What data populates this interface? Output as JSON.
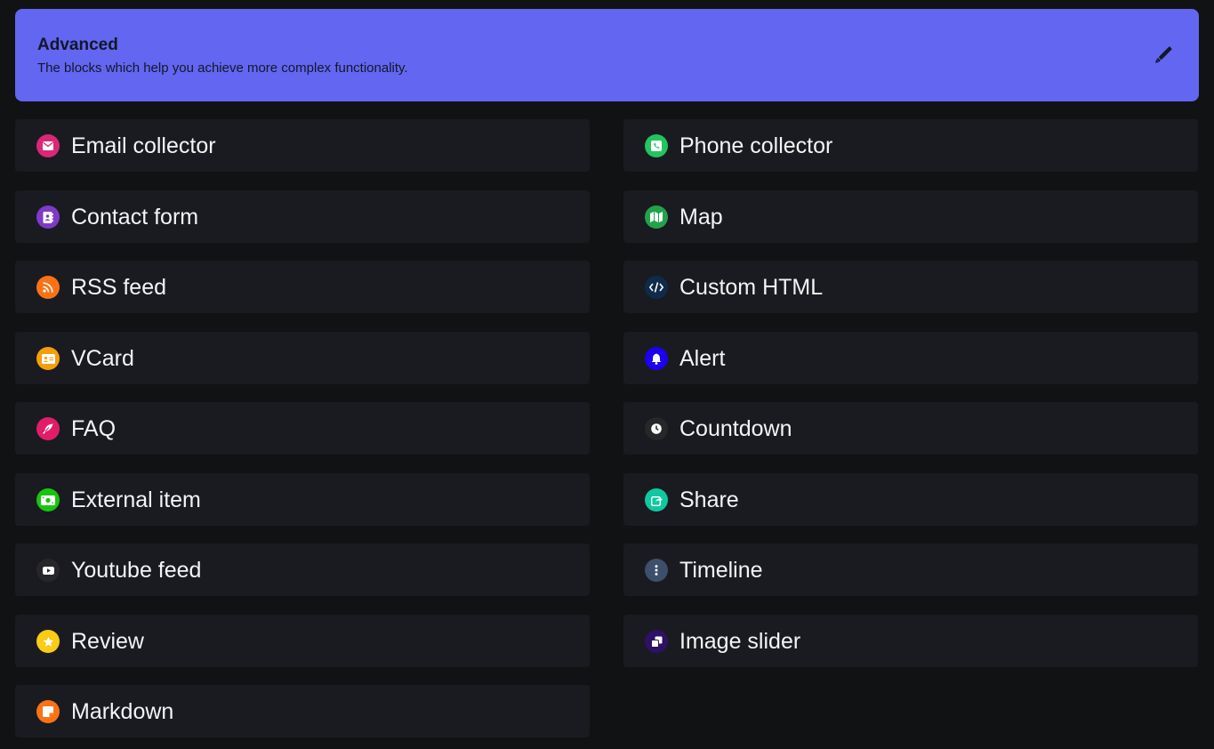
{
  "header": {
    "title": "Advanced",
    "subtitle": "The blocks which help you achieve more complex functionality.",
    "action_icon": "pencil-icon",
    "background_color": "#6366f1"
  },
  "blocks": [
    {
      "label": "Email collector",
      "icon": "envelope-icon",
      "color": "#db2777"
    },
    {
      "label": "Phone collector",
      "icon": "phone-square-icon",
      "color": "#22c55e"
    },
    {
      "label": "Contact form",
      "icon": "address-book-icon",
      "color": "#7e3ac9"
    },
    {
      "label": "Map",
      "icon": "map-icon",
      "color": "#22a34a"
    },
    {
      "label": "RSS feed",
      "icon": "rss-icon",
      "color": "#f97316"
    },
    {
      "label": "Custom HTML",
      "icon": "code-icon",
      "color": "#0f2a4a"
    },
    {
      "label": "VCard",
      "icon": "id-card-icon",
      "color": "#f59e0b"
    },
    {
      "label": "Alert",
      "icon": "bell-icon",
      "color": "#1d00f0"
    },
    {
      "label": "FAQ",
      "icon": "feather-icon",
      "color": "#e11d6a"
    },
    {
      "label": "Countdown",
      "icon": "clock-icon",
      "color": "#27272a"
    },
    {
      "label": "External item",
      "icon": "money-bill-icon",
      "color": "#16c60c"
    },
    {
      "label": "Share",
      "icon": "share-square-icon",
      "color": "#10c8a0"
    },
    {
      "label": "Youtube feed",
      "icon": "youtube-icon",
      "color": "#27272a"
    },
    {
      "label": "Timeline",
      "icon": "ellipsis-vertical-icon",
      "color": "#3d4f6b"
    },
    {
      "label": "Review",
      "icon": "star-icon",
      "color": "#facc15"
    },
    {
      "label": "Image slider",
      "icon": "clone-icon",
      "color": "#2e1065"
    },
    {
      "label": "Markdown",
      "icon": "sticky-note-icon",
      "color": "#f97316"
    }
  ]
}
